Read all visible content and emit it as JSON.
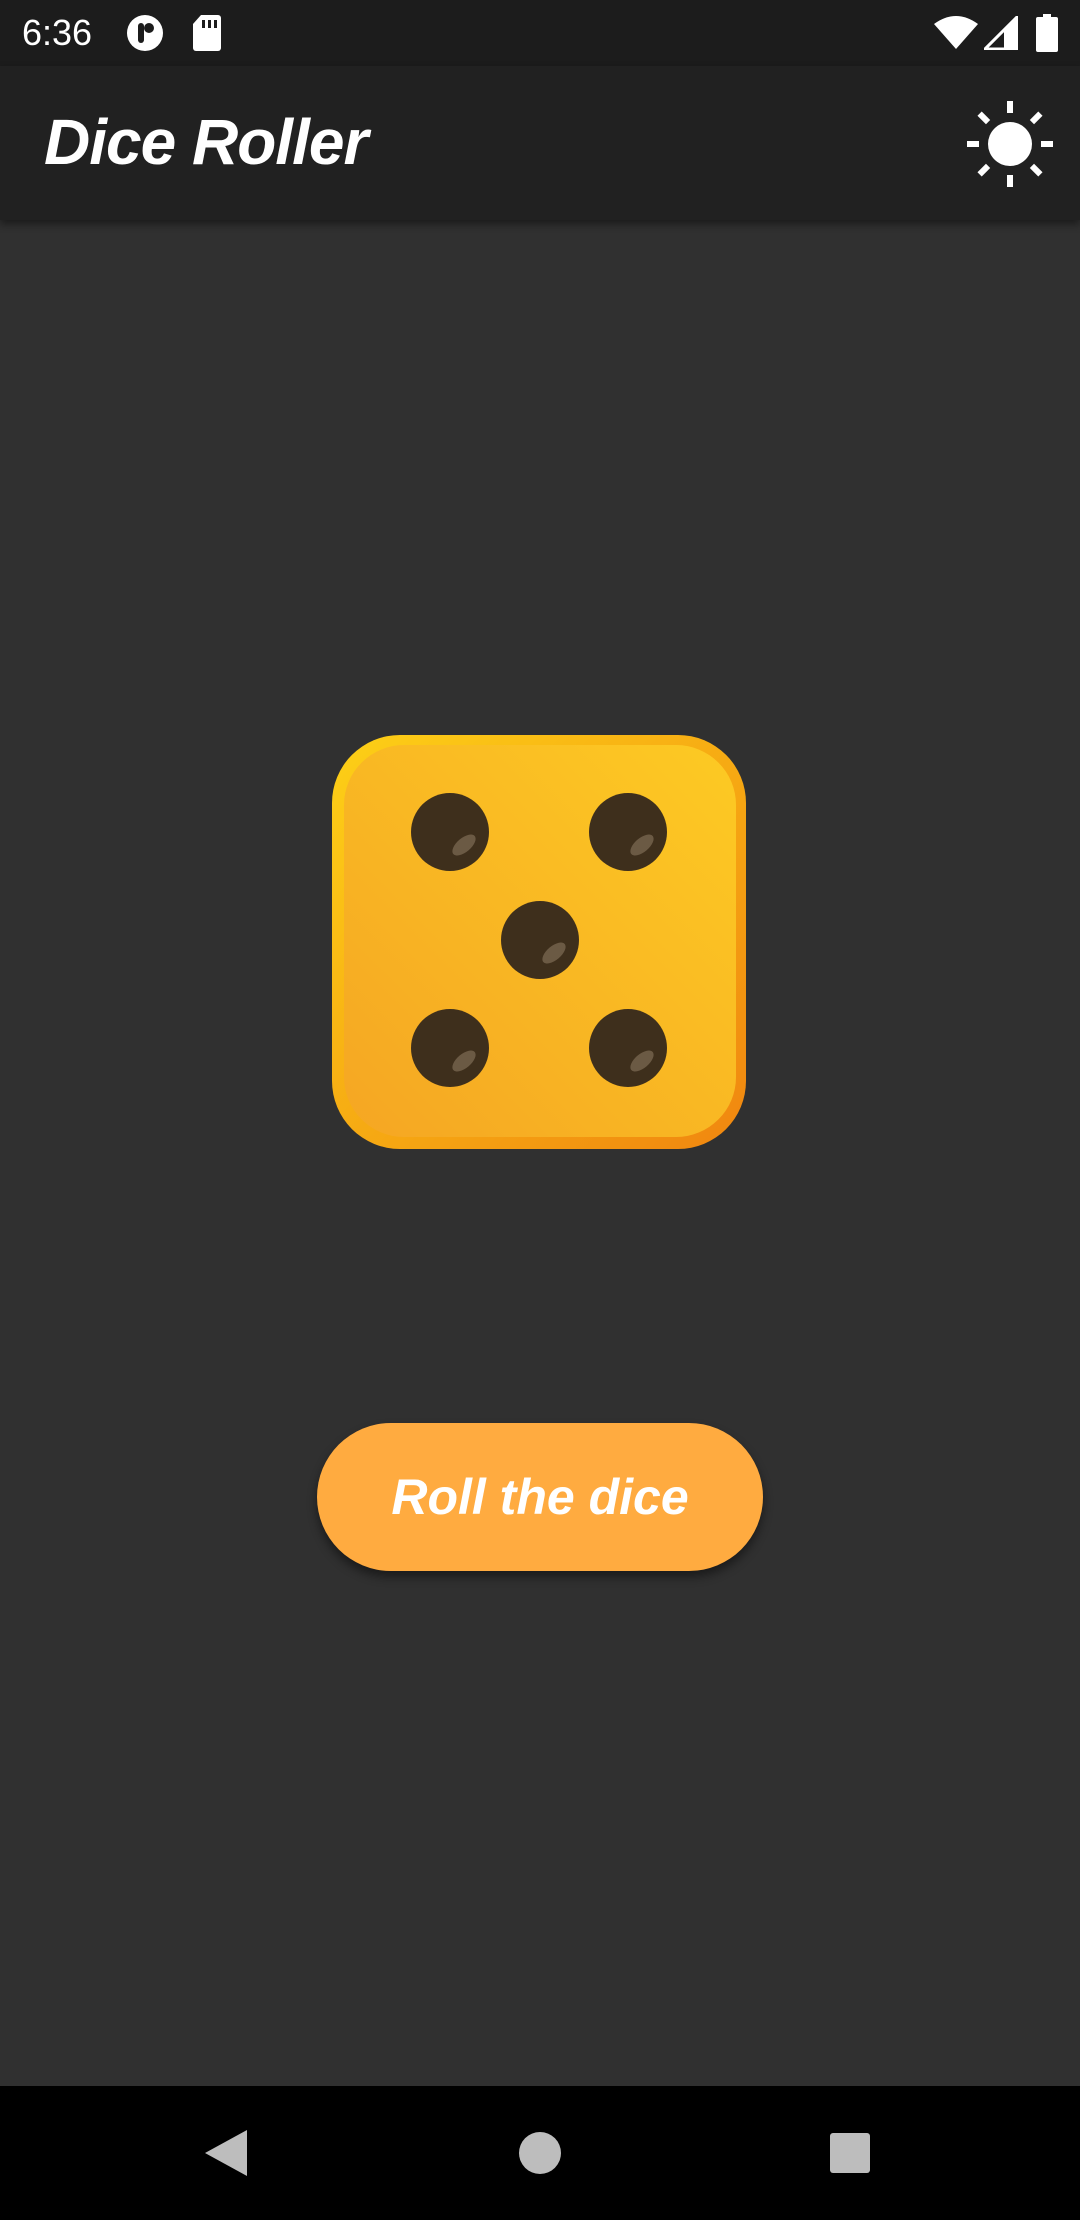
{
  "status_bar": {
    "time": "6:36",
    "icons": [
      "notification-app-icon",
      "sd-card-icon",
      "wifi-icon",
      "cellular-signal-icon",
      "battery-icon"
    ]
  },
  "app_bar": {
    "title": "Dice Roller",
    "action_icon": "brightness-icon"
  },
  "dice": {
    "face_value": 5,
    "colors": {
      "face_light": "#fbc02d",
      "face_dark": "#f5a623",
      "border": "#f9a825",
      "pip": "#3e2f1c"
    }
  },
  "roll_button": {
    "label": "Roll the dice",
    "color": "#ffab40"
  },
  "nav_bar": {
    "buttons": [
      "back-icon",
      "home-icon",
      "recents-icon"
    ]
  },
  "theme": {
    "background": "#303030",
    "app_bar": "#212121",
    "status_bar": "#1c1c1c"
  }
}
